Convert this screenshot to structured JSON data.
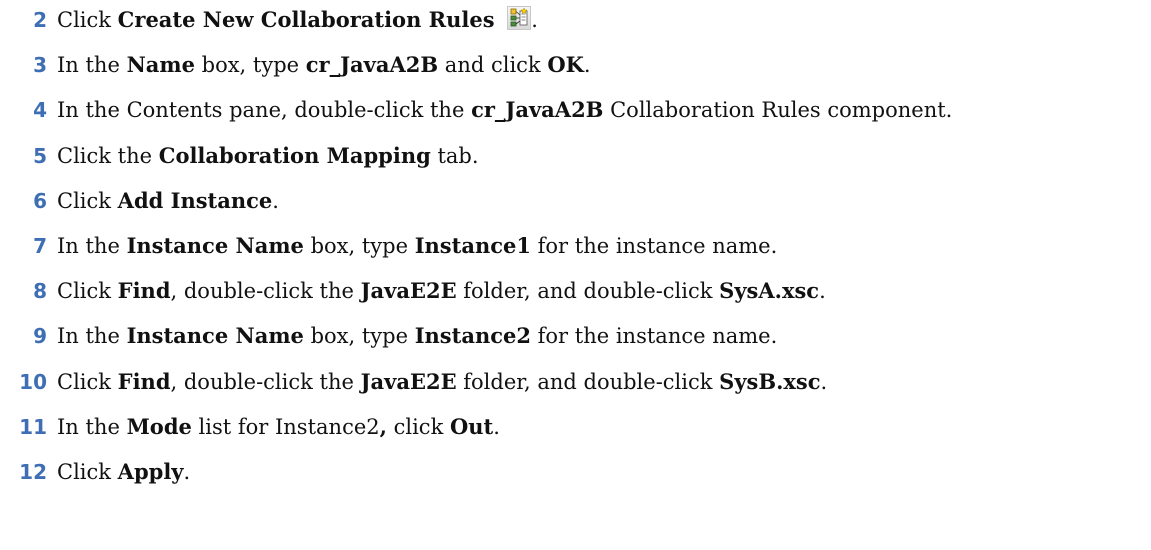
{
  "icons": {
    "create_rules": "create-collaboration-rules-icon"
  },
  "steps": [
    {
      "number": "2",
      "parts": [
        {
          "t": "Click "
        },
        {
          "b": "Create New Collaboration Rules"
        },
        {
          "t": " "
        },
        {
          "icon": "create_rules"
        },
        {
          "t": "."
        }
      ]
    },
    {
      "number": "3",
      "parts": [
        {
          "t": "In the "
        },
        {
          "b": "Name"
        },
        {
          "t": " box, type "
        },
        {
          "b": "cr_JavaA2B"
        },
        {
          "t": " and click "
        },
        {
          "b": "OK"
        },
        {
          "t": "."
        }
      ]
    },
    {
      "number": "4",
      "parts": [
        {
          "t": "In the Contents pane, double-click the "
        },
        {
          "b": "cr_JavaA2B"
        },
        {
          "t": " Collaboration Rules component."
        }
      ]
    },
    {
      "number": "5",
      "parts": [
        {
          "t": "Click the "
        },
        {
          "b": "Collaboration Mapping"
        },
        {
          "t": " tab."
        }
      ]
    },
    {
      "number": "6",
      "parts": [
        {
          "t": "Click "
        },
        {
          "b": "Add Instance"
        },
        {
          "t": "."
        }
      ]
    },
    {
      "number": "7",
      "parts": [
        {
          "t": "In the "
        },
        {
          "b": "Instance Name"
        },
        {
          "t": " box, type "
        },
        {
          "b": "Instance1"
        },
        {
          "t": " for the instance name."
        }
      ]
    },
    {
      "number": "8",
      "parts": [
        {
          "t": "Click "
        },
        {
          "b": "Find"
        },
        {
          "t": ", double-click the "
        },
        {
          "b": "JavaE2E"
        },
        {
          "t": " folder, and double-click "
        },
        {
          "b": "SysA.xsc"
        },
        {
          "t": "."
        }
      ]
    },
    {
      "number": "9",
      "parts": [
        {
          "t": "In the "
        },
        {
          "b": "Instance Name"
        },
        {
          "t": " box, type "
        },
        {
          "b": "Instance2"
        },
        {
          "t": " for the instance name."
        }
      ]
    },
    {
      "number": "10",
      "parts": [
        {
          "t": "Click "
        },
        {
          "b": "Find"
        },
        {
          "t": ", double-click the "
        },
        {
          "b": "JavaE2E"
        },
        {
          "t": " folder, and double-click "
        },
        {
          "b": "SysB.xsc"
        },
        {
          "t": "."
        }
      ]
    },
    {
      "number": "11",
      "parts": [
        {
          "t": "In the "
        },
        {
          "b": "Mode"
        },
        {
          "t": " list for Instance2"
        },
        {
          "b": ","
        },
        {
          "t": " click "
        },
        {
          "b": "Out"
        },
        {
          "t": "."
        }
      ]
    },
    {
      "number": "12",
      "parts": [
        {
          "t": "Click "
        },
        {
          "b": "Apply"
        },
        {
          "t": "."
        }
      ]
    }
  ]
}
